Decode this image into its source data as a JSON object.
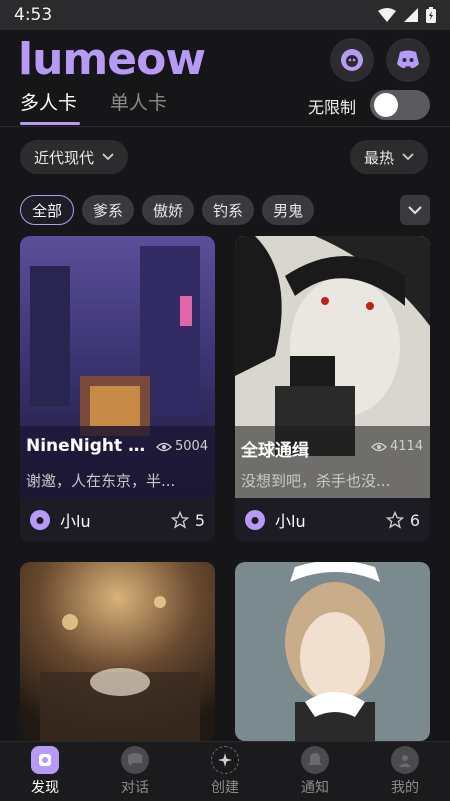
{
  "status_bar": {
    "time": "4:53"
  },
  "header": {
    "logo": "lumeow"
  },
  "tabs": [
    {
      "label": "多人卡",
      "active": true
    },
    {
      "label": "单人卡",
      "active": false
    }
  ],
  "filter": {
    "unlimited_label": "无限制",
    "unlimited_on": false,
    "era_dropdown": "近代现代",
    "sort_dropdown": "最热"
  },
  "chips": [
    "全部",
    "爹系",
    "傲娇",
    "钓系",
    "男鬼"
  ],
  "cards": [
    {
      "title": "NineNight Cl...",
      "views": "5004",
      "description": "谢邀，人在东京，半...",
      "author": "小lu",
      "stars": "5"
    },
    {
      "title": "全球通缉",
      "views": "4114",
      "description": "没想到吧，杀手也没...",
      "author": "小lu",
      "stars": "6"
    }
  ],
  "bottom_nav": [
    {
      "label": "发现",
      "icon": "discover-icon",
      "active": true
    },
    {
      "label": "对话",
      "icon": "chat-icon",
      "active": false
    },
    {
      "label": "创建",
      "icon": "create-icon",
      "active": false
    },
    {
      "label": "通知",
      "icon": "bell-icon",
      "active": false
    },
    {
      "label": "我的",
      "icon": "profile-icon",
      "active": false
    }
  ],
  "colors": {
    "accent": "#b69af5",
    "background": "#161618",
    "surface": "#2c2c2f"
  }
}
